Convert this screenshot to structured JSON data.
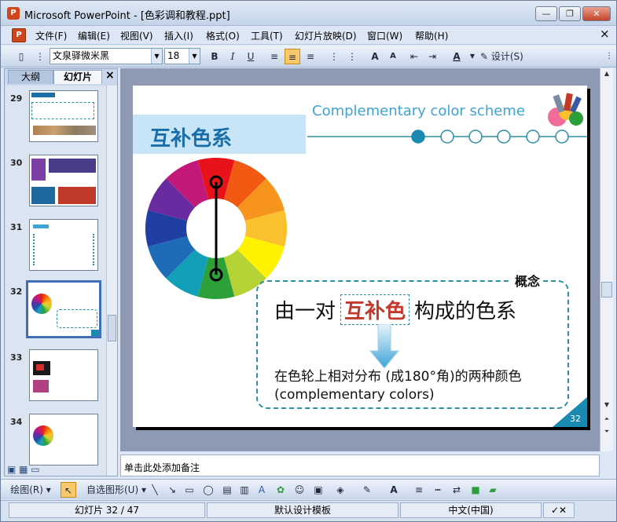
{
  "window": {
    "title": "Microsoft PowerPoint - [色彩调和教程.ppt]",
    "controls": [
      "—",
      "❐",
      "✕"
    ]
  },
  "menu": [
    "文件(F)",
    "编辑(E)",
    "视图(V)",
    "插入(I)",
    "格式(O)",
    "工具(T)",
    "幻灯片放映(D)",
    "窗口(W)",
    "帮助(H)"
  ],
  "menu_close": "×",
  "toolbar": {
    "font_name": "文泉驿微米黑",
    "font_size": "18",
    "design_label": "设计(S)"
  },
  "left_panel": {
    "tabs": [
      "大纲",
      "幻灯片"
    ],
    "close": "×",
    "slides": [
      {
        "num": "29"
      },
      {
        "num": "30"
      },
      {
        "num": "31"
      },
      {
        "num": "32",
        "selected": true
      },
      {
        "num": "33"
      },
      {
        "num": "34"
      }
    ]
  },
  "slide": {
    "title": "互补色系",
    "subtitle": "Complementary color scheme",
    "concept_label": "概念",
    "main_prefix": "由一对",
    "main_highlight": "互补色",
    "main_suffix": "构成的色系",
    "desc_line1": "在色轮上相对分布 (成180°角)的两种颜色",
    "desc_line2": "(complementary colors)",
    "page_number": "32",
    "highlight_color": "#c0392b",
    "accent_color": "#1a8ab0"
  },
  "notes": {
    "placeholder": "单击此处添加备注"
  },
  "drawbar": {
    "draw_label": "绘图(R)",
    "autoshapes_label": "自选图形(U)"
  },
  "status": {
    "slide_info": "幻灯片 32 / 47",
    "template": "默认设计模板",
    "language": "中文(中国)"
  }
}
